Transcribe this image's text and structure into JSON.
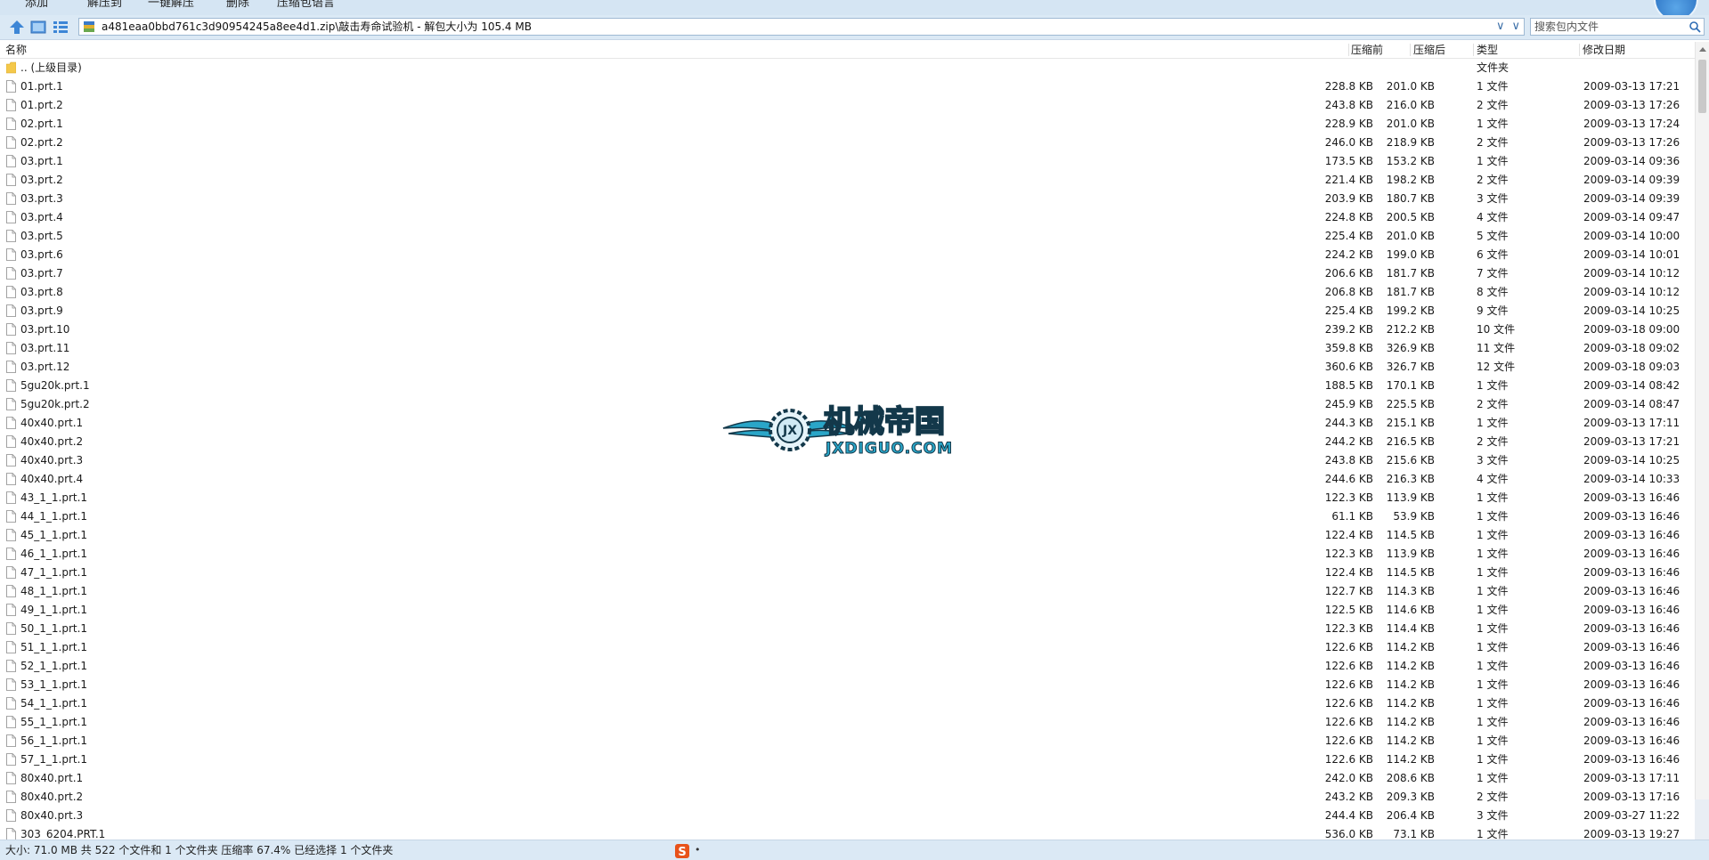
{
  "toolbar": {
    "buttons": [
      "添加",
      "解压到",
      "一键解压",
      "删除",
      "压缩包语言"
    ]
  },
  "address": {
    "path": "a481eaa0bbd761c3d90954245a8ee4d1.zip\\敲击寿命试验机 - 解包大小为 105.4 MB",
    "search_placeholder": "搜索包内文件"
  },
  "columns": {
    "name": "名称",
    "before": "压缩前",
    "after": "压缩后",
    "type": "类型",
    "date": "修改日期"
  },
  "rows": [
    {
      "name": ".. (上级目录)",
      "before": "",
      "after": "",
      "type": "文件夹",
      "date": "",
      "folder": true
    },
    {
      "name": "01.prt.1",
      "before": "228.8 KB",
      "after": "201.0 KB",
      "type": "1 文件",
      "date": "2009-03-13 17:21"
    },
    {
      "name": "01.prt.2",
      "before": "243.8 KB",
      "after": "216.0 KB",
      "type": "2 文件",
      "date": "2009-03-13 17:26"
    },
    {
      "name": "02.prt.1",
      "before": "228.9 KB",
      "after": "201.0 KB",
      "type": "1 文件",
      "date": "2009-03-13 17:24"
    },
    {
      "name": "02.prt.2",
      "before": "246.0 KB",
      "after": "218.9 KB",
      "type": "2 文件",
      "date": "2009-03-13 17:26"
    },
    {
      "name": "03.prt.1",
      "before": "173.5 KB",
      "after": "153.2 KB",
      "type": "1 文件",
      "date": "2009-03-14 09:36"
    },
    {
      "name": "03.prt.2",
      "before": "221.4 KB",
      "after": "198.2 KB",
      "type": "2 文件",
      "date": "2009-03-14 09:39"
    },
    {
      "name": "03.prt.3",
      "before": "203.9 KB",
      "after": "180.7 KB",
      "type": "3 文件",
      "date": "2009-03-14 09:39"
    },
    {
      "name": "03.prt.4",
      "before": "224.8 KB",
      "after": "200.5 KB",
      "type": "4 文件",
      "date": "2009-03-14 09:47"
    },
    {
      "name": "03.prt.5",
      "before": "225.4 KB",
      "after": "201.0 KB",
      "type": "5 文件",
      "date": "2009-03-14 10:00"
    },
    {
      "name": "03.prt.6",
      "before": "224.2 KB",
      "after": "199.0 KB",
      "type": "6 文件",
      "date": "2009-03-14 10:01"
    },
    {
      "name": "03.prt.7",
      "before": "206.6 KB",
      "after": "181.7 KB",
      "type": "7 文件",
      "date": "2009-03-14 10:12"
    },
    {
      "name": "03.prt.8",
      "before": "206.8 KB",
      "after": "181.7 KB",
      "type": "8 文件",
      "date": "2009-03-14 10:12"
    },
    {
      "name": "03.prt.9",
      "before": "225.4 KB",
      "after": "199.2 KB",
      "type": "9 文件",
      "date": "2009-03-14 10:25"
    },
    {
      "name": "03.prt.10",
      "before": "239.2 KB",
      "after": "212.2 KB",
      "type": "10 文件",
      "date": "2009-03-18 09:00"
    },
    {
      "name": "03.prt.11",
      "before": "359.8 KB",
      "after": "326.9 KB",
      "type": "11 文件",
      "date": "2009-03-18 09:02"
    },
    {
      "name": "03.prt.12",
      "before": "360.6 KB",
      "after": "326.7 KB",
      "type": "12 文件",
      "date": "2009-03-18 09:03"
    },
    {
      "name": "5gu20k.prt.1",
      "before": "188.5 KB",
      "after": "170.1 KB",
      "type": "1 文件",
      "date": "2009-03-14 08:42"
    },
    {
      "name": "5gu20k.prt.2",
      "before": "245.9 KB",
      "after": "225.5 KB",
      "type": "2 文件",
      "date": "2009-03-14 08:47"
    },
    {
      "name": "40x40.prt.1",
      "before": "244.3 KB",
      "after": "215.1 KB",
      "type": "1 文件",
      "date": "2009-03-13 17:11"
    },
    {
      "name": "40x40.prt.2",
      "before": "244.2 KB",
      "after": "216.5 KB",
      "type": "2 文件",
      "date": "2009-03-13 17:21"
    },
    {
      "name": "40x40.prt.3",
      "before": "243.8 KB",
      "after": "215.6 KB",
      "type": "3 文件",
      "date": "2009-03-14 10:25"
    },
    {
      "name": "40x40.prt.4",
      "before": "244.6 KB",
      "after": "216.3 KB",
      "type": "4 文件",
      "date": "2009-03-14 10:33"
    },
    {
      "name": "43_1_1.prt.1",
      "before": "122.3 KB",
      "after": "113.9 KB",
      "type": "1 文件",
      "date": "2009-03-13 16:46"
    },
    {
      "name": "44_1_1.prt.1",
      "before": "61.1 KB",
      "after": "53.9 KB",
      "type": "1 文件",
      "date": "2009-03-13 16:46"
    },
    {
      "name": "45_1_1.prt.1",
      "before": "122.4 KB",
      "after": "114.5 KB",
      "type": "1 文件",
      "date": "2009-03-13 16:46"
    },
    {
      "name": "46_1_1.prt.1",
      "before": "122.3 KB",
      "after": "113.9 KB",
      "type": "1 文件",
      "date": "2009-03-13 16:46"
    },
    {
      "name": "47_1_1.prt.1",
      "before": "122.4 KB",
      "after": "114.5 KB",
      "type": "1 文件",
      "date": "2009-03-13 16:46"
    },
    {
      "name": "48_1_1.prt.1",
      "before": "122.7 KB",
      "after": "114.3 KB",
      "type": "1 文件",
      "date": "2009-03-13 16:46"
    },
    {
      "name": "49_1_1.prt.1",
      "before": "122.5 KB",
      "after": "114.6 KB",
      "type": "1 文件",
      "date": "2009-03-13 16:46"
    },
    {
      "name": "50_1_1.prt.1",
      "before": "122.3 KB",
      "after": "114.4 KB",
      "type": "1 文件",
      "date": "2009-03-13 16:46"
    },
    {
      "name": "51_1_1.prt.1",
      "before": "122.6 KB",
      "after": "114.2 KB",
      "type": "1 文件",
      "date": "2009-03-13 16:46"
    },
    {
      "name": "52_1_1.prt.1",
      "before": "122.6 KB",
      "after": "114.2 KB",
      "type": "1 文件",
      "date": "2009-03-13 16:46"
    },
    {
      "name": "53_1_1.prt.1",
      "before": "122.6 KB",
      "after": "114.2 KB",
      "type": "1 文件",
      "date": "2009-03-13 16:46"
    },
    {
      "name": "54_1_1.prt.1",
      "before": "122.6 KB",
      "after": "114.2 KB",
      "type": "1 文件",
      "date": "2009-03-13 16:46"
    },
    {
      "name": "55_1_1.prt.1",
      "before": "122.6 KB",
      "after": "114.2 KB",
      "type": "1 文件",
      "date": "2009-03-13 16:46"
    },
    {
      "name": "56_1_1.prt.1",
      "before": "122.6 KB",
      "after": "114.2 KB",
      "type": "1 文件",
      "date": "2009-03-13 16:46"
    },
    {
      "name": "57_1_1.prt.1",
      "before": "122.6 KB",
      "after": "114.2 KB",
      "type": "1 文件",
      "date": "2009-03-13 16:46"
    },
    {
      "name": "80x40.prt.1",
      "before": "242.0 KB",
      "after": "208.6 KB",
      "type": "1 文件",
      "date": "2009-03-13 17:11"
    },
    {
      "name": "80x40.prt.2",
      "before": "243.2 KB",
      "after": "209.3 KB",
      "type": "2 文件",
      "date": "2009-03-13 17:16"
    },
    {
      "name": "80x40.prt.3",
      "before": "244.4 KB",
      "after": "206.4 KB",
      "type": "3 文件",
      "date": "2009-03-27 11:22"
    },
    {
      "name": "303_6204.PRT.1",
      "before": "536.0 KB",
      "after": "73.1 KB",
      "type": "1 文件",
      "date": "2009-03-13 19:27"
    }
  ],
  "watermark": {
    "title": "机械帝国",
    "url": "JXDIGUO.COM",
    "badge": "JX"
  },
  "status": {
    "text": "大小: 71.0 MB 共 522 个文件和 1 个文件夹 压缩率 67.4% 已经选择 1 个文件夹",
    "ime_label": "S"
  },
  "colors": {
    "toolbar_bg": "#d5e5f3",
    "watermark_blue": "#2aa6c8",
    "watermark_dark": "#13384a",
    "ime_red": "#e8521a"
  }
}
